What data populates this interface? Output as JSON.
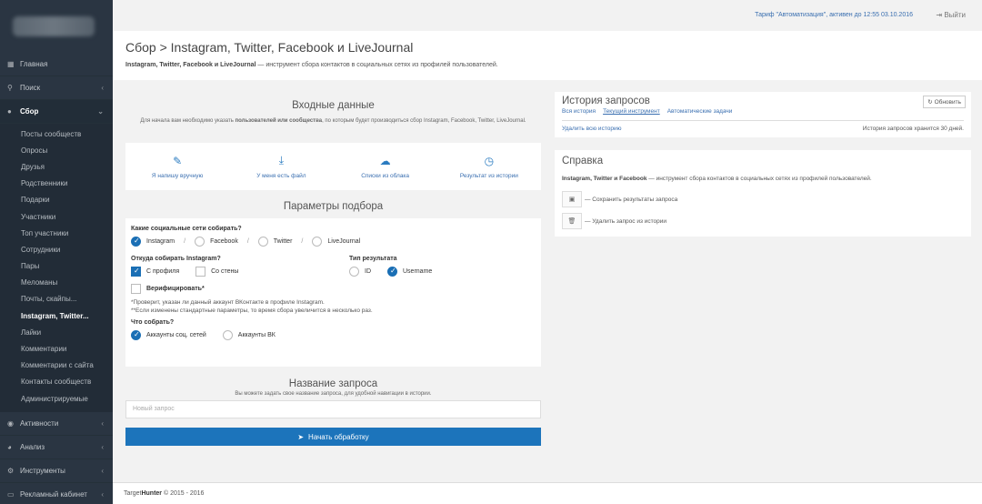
{
  "sidebar": {
    "nav_top": [
      {
        "icon": "grid-icon",
        "label": "Главная"
      },
      {
        "icon": "search-icon",
        "label": "Поиск"
      },
      {
        "icon": "globe-icon",
        "label": "Сбор"
      }
    ],
    "sub_items": [
      "Посты сообществ",
      "Опросы",
      "Друзья",
      "Родственники",
      "Подарки",
      "Участники",
      "Топ участники",
      "Сотрудники",
      "Пары",
      "Меломаны",
      "Почты, скайпы...",
      "Instagram, Twitter...",
      "Лайки",
      "Комментарии",
      "Комментарии с сайта",
      "Контакты сообществ",
      "Администрируемые"
    ],
    "nav_bottom": [
      {
        "icon": "eye-icon",
        "label": "Активности"
      },
      {
        "icon": "pie-chart-icon",
        "label": "Анализ"
      },
      {
        "icon": "gear-icon",
        "label": "Инструменты"
      },
      {
        "icon": "wallet-icon",
        "label": "Рекламный кабинет"
      }
    ]
  },
  "topbar": {
    "tariff": "Тариф \"Автоматизация\", активен до 12:55 03.10.2016",
    "logout": "Выйти"
  },
  "header": {
    "title": "Сбор > Instagram, Twitter, Facebook и LiveJournal",
    "desc_bold": "Instagram, Twitter, Facebook и LiveJournal",
    "desc_rest": " — инструмент сбора контактов в социальных сетях из профилей пользователей."
  },
  "input": {
    "title": "Входные данные",
    "sub_pre": "Для начала вам необходимо указать ",
    "sub_bold": "пользователей или сообщества",
    "sub_post": ", по которым будет производиться сбор Instagram, Facebook, Twitter, LiveJournal.",
    "options": [
      {
        "icon": "pencil-icon",
        "label": "Я напишу вручную"
      },
      {
        "icon": "download-icon",
        "label": "У меня есть файл"
      },
      {
        "icon": "cloud-icon",
        "label": "Списки из облака"
      },
      {
        "icon": "clock-icon",
        "label": "Результат из истории"
      }
    ]
  },
  "params": {
    "title": "Параметры подбора",
    "networks_label": "Какие социальные сети собирать?",
    "networks": [
      {
        "label": "Instagram",
        "checked": true
      },
      {
        "label": "Facebook",
        "checked": false
      },
      {
        "label": "Twitter",
        "checked": false
      },
      {
        "label": "LiveJournal",
        "checked": false
      }
    ],
    "source_label": "Откуда собирать Instagram?",
    "source_profile": "С профиля",
    "source_wall": "Со стены",
    "result_label": "Тип результата",
    "result_id": "ID",
    "result_username": "Username",
    "verify": "Верифицировать*",
    "note1": "*Проверит, указан ли данный аккаунт ВКонтакте в профиле Instagram.",
    "note2": "**Если изменены стандартные параметры, то время сбора увеличится в несколько раз.",
    "collect_label": "Что собрать?",
    "collect_social": "Аккаунты соц. сетей",
    "collect_vk": "Аккаунты ВК"
  },
  "query": {
    "title": "Название запроса",
    "sub": "Вы можете задать свое название запроса, для удобной навигации в истории.",
    "placeholder": "Новый запрос",
    "start": "Начать обработку"
  },
  "history": {
    "title": "История запросов",
    "refresh": "Обновить",
    "tabs": [
      "Вся история",
      "Текущий инструмент",
      "Автоматические задачи"
    ],
    "delete_all": "Удалить всю историю",
    "keep_note": "История запросов хранится 30 дней."
  },
  "help": {
    "title": "Справка",
    "desc_bold": "Instagram, Twitter и Facebook",
    "desc_rest": " — инструмент сбора контактов в социальных сетях из профилей пользователей.",
    "save": "— Сохранить результаты запроса",
    "delete": "— Удалить запрос из истории"
  },
  "footer": {
    "pre": "Target",
    "bold": "Hunter",
    "post": " © 2015 - 2016"
  }
}
